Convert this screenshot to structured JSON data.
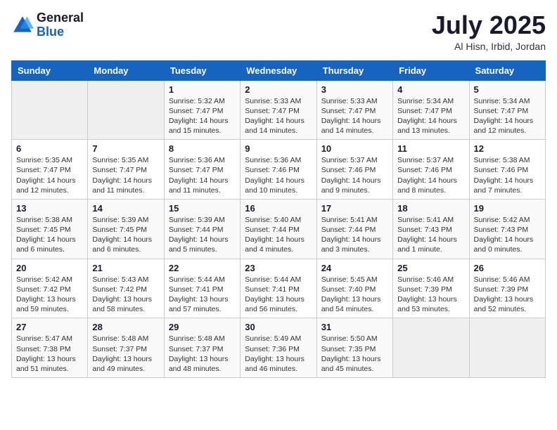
{
  "header": {
    "logo_general": "General",
    "logo_blue": "Blue",
    "month_year": "July 2025",
    "location": "Al Hisn, Irbid, Jordan"
  },
  "weekdays": [
    "Sunday",
    "Monday",
    "Tuesday",
    "Wednesday",
    "Thursday",
    "Friday",
    "Saturday"
  ],
  "weeks": [
    [
      null,
      null,
      {
        "day": 1,
        "sunrise": "5:32 AM",
        "sunset": "7:47 PM",
        "daylight": "14 hours and 15 minutes."
      },
      {
        "day": 2,
        "sunrise": "5:33 AM",
        "sunset": "7:47 PM",
        "daylight": "14 hours and 14 minutes."
      },
      {
        "day": 3,
        "sunrise": "5:33 AM",
        "sunset": "7:47 PM",
        "daylight": "14 hours and 14 minutes."
      },
      {
        "day": 4,
        "sunrise": "5:34 AM",
        "sunset": "7:47 PM",
        "daylight": "14 hours and 13 minutes."
      },
      {
        "day": 5,
        "sunrise": "5:34 AM",
        "sunset": "7:47 PM",
        "daylight": "14 hours and 12 minutes."
      }
    ],
    [
      {
        "day": 6,
        "sunrise": "5:35 AM",
        "sunset": "7:47 PM",
        "daylight": "14 hours and 12 minutes."
      },
      {
        "day": 7,
        "sunrise": "5:35 AM",
        "sunset": "7:47 PM",
        "daylight": "14 hours and 11 minutes."
      },
      {
        "day": 8,
        "sunrise": "5:36 AM",
        "sunset": "7:47 PM",
        "daylight": "14 hours and 11 minutes."
      },
      {
        "day": 9,
        "sunrise": "5:36 AM",
        "sunset": "7:46 PM",
        "daylight": "14 hours and 10 minutes."
      },
      {
        "day": 10,
        "sunrise": "5:37 AM",
        "sunset": "7:46 PM",
        "daylight": "14 hours and 9 minutes."
      },
      {
        "day": 11,
        "sunrise": "5:37 AM",
        "sunset": "7:46 PM",
        "daylight": "14 hours and 8 minutes."
      },
      {
        "day": 12,
        "sunrise": "5:38 AM",
        "sunset": "7:46 PM",
        "daylight": "14 hours and 7 minutes."
      }
    ],
    [
      {
        "day": 13,
        "sunrise": "5:38 AM",
        "sunset": "7:45 PM",
        "daylight": "14 hours and 6 minutes."
      },
      {
        "day": 14,
        "sunrise": "5:39 AM",
        "sunset": "7:45 PM",
        "daylight": "14 hours and 6 minutes."
      },
      {
        "day": 15,
        "sunrise": "5:39 AM",
        "sunset": "7:44 PM",
        "daylight": "14 hours and 5 minutes."
      },
      {
        "day": 16,
        "sunrise": "5:40 AM",
        "sunset": "7:44 PM",
        "daylight": "14 hours and 4 minutes."
      },
      {
        "day": 17,
        "sunrise": "5:41 AM",
        "sunset": "7:44 PM",
        "daylight": "14 hours and 3 minutes."
      },
      {
        "day": 18,
        "sunrise": "5:41 AM",
        "sunset": "7:43 PM",
        "daylight": "14 hours and 1 minute."
      },
      {
        "day": 19,
        "sunrise": "5:42 AM",
        "sunset": "7:43 PM",
        "daylight": "14 hours and 0 minutes."
      }
    ],
    [
      {
        "day": 20,
        "sunrise": "5:42 AM",
        "sunset": "7:42 PM",
        "daylight": "13 hours and 59 minutes."
      },
      {
        "day": 21,
        "sunrise": "5:43 AM",
        "sunset": "7:42 PM",
        "daylight": "13 hours and 58 minutes."
      },
      {
        "day": 22,
        "sunrise": "5:44 AM",
        "sunset": "7:41 PM",
        "daylight": "13 hours and 57 minutes."
      },
      {
        "day": 23,
        "sunrise": "5:44 AM",
        "sunset": "7:41 PM",
        "daylight": "13 hours and 56 minutes."
      },
      {
        "day": 24,
        "sunrise": "5:45 AM",
        "sunset": "7:40 PM",
        "daylight": "13 hours and 54 minutes."
      },
      {
        "day": 25,
        "sunrise": "5:46 AM",
        "sunset": "7:39 PM",
        "daylight": "13 hours and 53 minutes."
      },
      {
        "day": 26,
        "sunrise": "5:46 AM",
        "sunset": "7:39 PM",
        "daylight": "13 hours and 52 minutes."
      }
    ],
    [
      {
        "day": 27,
        "sunrise": "5:47 AM",
        "sunset": "7:38 PM",
        "daylight": "13 hours and 51 minutes."
      },
      {
        "day": 28,
        "sunrise": "5:48 AM",
        "sunset": "7:37 PM",
        "daylight": "13 hours and 49 minutes."
      },
      {
        "day": 29,
        "sunrise": "5:48 AM",
        "sunset": "7:37 PM",
        "daylight": "13 hours and 48 minutes."
      },
      {
        "day": 30,
        "sunrise": "5:49 AM",
        "sunset": "7:36 PM",
        "daylight": "13 hours and 46 minutes."
      },
      {
        "day": 31,
        "sunrise": "5:50 AM",
        "sunset": "7:35 PM",
        "daylight": "13 hours and 45 minutes."
      },
      null,
      null
    ]
  ]
}
